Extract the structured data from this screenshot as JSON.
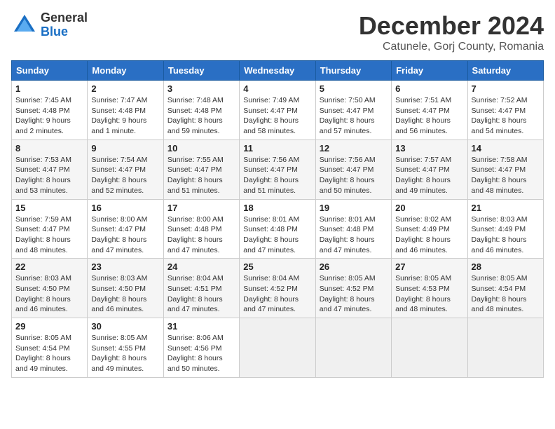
{
  "header": {
    "logo": {
      "line1": "General",
      "line2": "Blue"
    },
    "title": "December 2024",
    "subtitle": "Catunele, Gorj County, Romania"
  },
  "days_of_week": [
    "Sunday",
    "Monday",
    "Tuesday",
    "Wednesday",
    "Thursday",
    "Friday",
    "Saturday"
  ],
  "weeks": [
    [
      {
        "day": "1",
        "sunrise": "7:45 AM",
        "sunset": "4:48 PM",
        "daylight": "9 hours and 2 minutes."
      },
      {
        "day": "2",
        "sunrise": "7:47 AM",
        "sunset": "4:48 PM",
        "daylight": "9 hours and 1 minute."
      },
      {
        "day": "3",
        "sunrise": "7:48 AM",
        "sunset": "4:48 PM",
        "daylight": "8 hours and 59 minutes."
      },
      {
        "day": "4",
        "sunrise": "7:49 AM",
        "sunset": "4:47 PM",
        "daylight": "8 hours and 58 minutes."
      },
      {
        "day": "5",
        "sunrise": "7:50 AM",
        "sunset": "4:47 PM",
        "daylight": "8 hours and 57 minutes."
      },
      {
        "day": "6",
        "sunrise": "7:51 AM",
        "sunset": "4:47 PM",
        "daylight": "8 hours and 56 minutes."
      },
      {
        "day": "7",
        "sunrise": "7:52 AM",
        "sunset": "4:47 PM",
        "daylight": "8 hours and 54 minutes."
      }
    ],
    [
      {
        "day": "8",
        "sunrise": "7:53 AM",
        "sunset": "4:47 PM",
        "daylight": "8 hours and 53 minutes."
      },
      {
        "day": "9",
        "sunrise": "7:54 AM",
        "sunset": "4:47 PM",
        "daylight": "8 hours and 52 minutes."
      },
      {
        "day": "10",
        "sunrise": "7:55 AM",
        "sunset": "4:47 PM",
        "daylight": "8 hours and 51 minutes."
      },
      {
        "day": "11",
        "sunrise": "7:56 AM",
        "sunset": "4:47 PM",
        "daylight": "8 hours and 51 minutes."
      },
      {
        "day": "12",
        "sunrise": "7:56 AM",
        "sunset": "4:47 PM",
        "daylight": "8 hours and 50 minutes."
      },
      {
        "day": "13",
        "sunrise": "7:57 AM",
        "sunset": "4:47 PM",
        "daylight": "8 hours and 49 minutes."
      },
      {
        "day": "14",
        "sunrise": "7:58 AM",
        "sunset": "4:47 PM",
        "daylight": "8 hours and 48 minutes."
      }
    ],
    [
      {
        "day": "15",
        "sunrise": "7:59 AM",
        "sunset": "4:47 PM",
        "daylight": "8 hours and 48 minutes."
      },
      {
        "day": "16",
        "sunrise": "8:00 AM",
        "sunset": "4:47 PM",
        "daylight": "8 hours and 47 minutes."
      },
      {
        "day": "17",
        "sunrise": "8:00 AM",
        "sunset": "4:48 PM",
        "daylight": "8 hours and 47 minutes."
      },
      {
        "day": "18",
        "sunrise": "8:01 AM",
        "sunset": "4:48 PM",
        "daylight": "8 hours and 47 minutes."
      },
      {
        "day": "19",
        "sunrise": "8:01 AM",
        "sunset": "4:48 PM",
        "daylight": "8 hours and 47 minutes."
      },
      {
        "day": "20",
        "sunrise": "8:02 AM",
        "sunset": "4:49 PM",
        "daylight": "8 hours and 46 minutes."
      },
      {
        "day": "21",
        "sunrise": "8:03 AM",
        "sunset": "4:49 PM",
        "daylight": "8 hours and 46 minutes."
      }
    ],
    [
      {
        "day": "22",
        "sunrise": "8:03 AM",
        "sunset": "4:50 PM",
        "daylight": "8 hours and 46 minutes."
      },
      {
        "day": "23",
        "sunrise": "8:03 AM",
        "sunset": "4:50 PM",
        "daylight": "8 hours and 46 minutes."
      },
      {
        "day": "24",
        "sunrise": "8:04 AM",
        "sunset": "4:51 PM",
        "daylight": "8 hours and 47 minutes."
      },
      {
        "day": "25",
        "sunrise": "8:04 AM",
        "sunset": "4:52 PM",
        "daylight": "8 hours and 47 minutes."
      },
      {
        "day": "26",
        "sunrise": "8:05 AM",
        "sunset": "4:52 PM",
        "daylight": "8 hours and 47 minutes."
      },
      {
        "day": "27",
        "sunrise": "8:05 AM",
        "sunset": "4:53 PM",
        "daylight": "8 hours and 48 minutes."
      },
      {
        "day": "28",
        "sunrise": "8:05 AM",
        "sunset": "4:54 PM",
        "daylight": "8 hours and 48 minutes."
      }
    ],
    [
      {
        "day": "29",
        "sunrise": "8:05 AM",
        "sunset": "4:54 PM",
        "daylight": "8 hours and 49 minutes."
      },
      {
        "day": "30",
        "sunrise": "8:05 AM",
        "sunset": "4:55 PM",
        "daylight": "8 hours and 49 minutes."
      },
      {
        "day": "31",
        "sunrise": "8:06 AM",
        "sunset": "4:56 PM",
        "daylight": "8 hours and 50 minutes."
      },
      null,
      null,
      null,
      null
    ]
  ]
}
